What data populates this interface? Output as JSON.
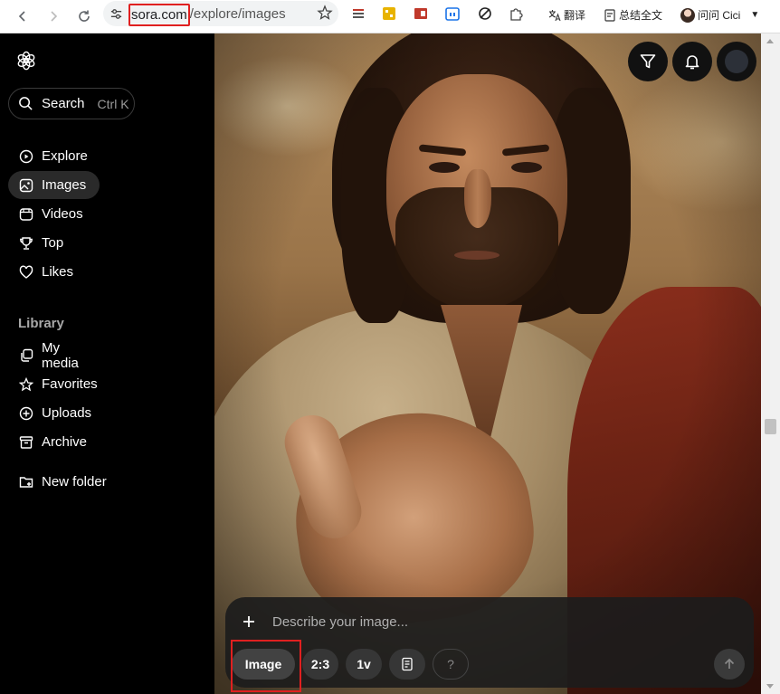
{
  "browser": {
    "url_host": "sora.com",
    "url_path": "/explore/images",
    "ext_translate": "翻译",
    "ext_summary": "总结全文",
    "profile_name": "问问 Cici"
  },
  "sidebar": {
    "search_label": "Search",
    "search_shortcut": "Ctrl K",
    "nav": [
      {
        "label": "Explore",
        "icon": "compass-icon"
      },
      {
        "label": "Images",
        "icon": "image-icon",
        "active": true
      },
      {
        "label": "Videos",
        "icon": "video-icon"
      },
      {
        "label": "Top",
        "icon": "trophy-icon"
      },
      {
        "label": "Likes",
        "icon": "heart-icon"
      }
    ],
    "library_title": "Library",
    "library": [
      {
        "label": "My media",
        "icon": "media-icon"
      },
      {
        "label": "Favorites",
        "icon": "star-icon"
      },
      {
        "label": "Uploads",
        "icon": "upload-icon"
      },
      {
        "label": "Archive",
        "icon": "archive-icon"
      }
    ],
    "new_folder": "New folder"
  },
  "composer": {
    "placeholder": "Describe your image...",
    "chips": {
      "type": "Image",
      "ratio": "2:3",
      "variations": "1v",
      "help": "?"
    }
  },
  "colors": {
    "accent_highlight": "#e02020",
    "background": "#000000"
  }
}
